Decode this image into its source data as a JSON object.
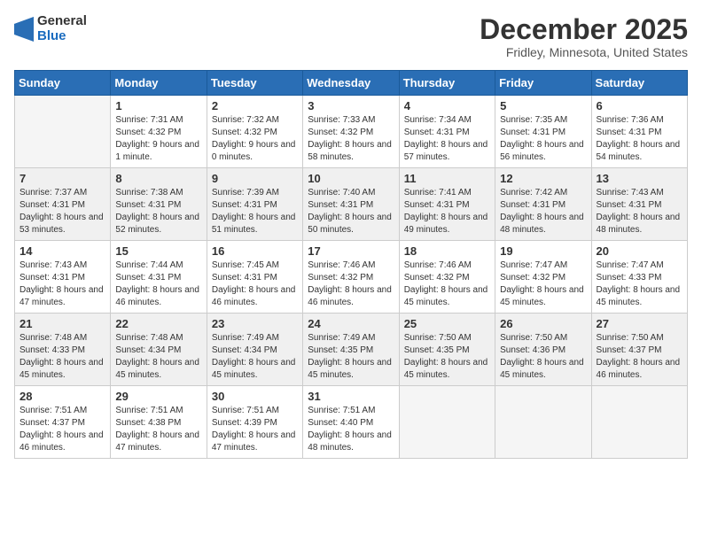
{
  "logo": {
    "general": "General",
    "blue": "Blue"
  },
  "title": "December 2025",
  "location": "Fridley, Minnesota, United States",
  "days_header": [
    "Sunday",
    "Monday",
    "Tuesday",
    "Wednesday",
    "Thursday",
    "Friday",
    "Saturday"
  ],
  "weeks": [
    [
      {
        "num": "",
        "empty": true
      },
      {
        "num": "1",
        "sunrise": "Sunrise: 7:31 AM",
        "sunset": "Sunset: 4:32 PM",
        "daylight": "Daylight: 9 hours and 1 minute."
      },
      {
        "num": "2",
        "sunrise": "Sunrise: 7:32 AM",
        "sunset": "Sunset: 4:32 PM",
        "daylight": "Daylight: 9 hours and 0 minutes."
      },
      {
        "num": "3",
        "sunrise": "Sunrise: 7:33 AM",
        "sunset": "Sunset: 4:32 PM",
        "daylight": "Daylight: 8 hours and 58 minutes."
      },
      {
        "num": "4",
        "sunrise": "Sunrise: 7:34 AM",
        "sunset": "Sunset: 4:31 PM",
        "daylight": "Daylight: 8 hours and 57 minutes."
      },
      {
        "num": "5",
        "sunrise": "Sunrise: 7:35 AM",
        "sunset": "Sunset: 4:31 PM",
        "daylight": "Daylight: 8 hours and 56 minutes."
      },
      {
        "num": "6",
        "sunrise": "Sunrise: 7:36 AM",
        "sunset": "Sunset: 4:31 PM",
        "daylight": "Daylight: 8 hours and 54 minutes."
      }
    ],
    [
      {
        "num": "7",
        "sunrise": "Sunrise: 7:37 AM",
        "sunset": "Sunset: 4:31 PM",
        "daylight": "Daylight: 8 hours and 53 minutes."
      },
      {
        "num": "8",
        "sunrise": "Sunrise: 7:38 AM",
        "sunset": "Sunset: 4:31 PM",
        "daylight": "Daylight: 8 hours and 52 minutes."
      },
      {
        "num": "9",
        "sunrise": "Sunrise: 7:39 AM",
        "sunset": "Sunset: 4:31 PM",
        "daylight": "Daylight: 8 hours and 51 minutes."
      },
      {
        "num": "10",
        "sunrise": "Sunrise: 7:40 AM",
        "sunset": "Sunset: 4:31 PM",
        "daylight": "Daylight: 8 hours and 50 minutes."
      },
      {
        "num": "11",
        "sunrise": "Sunrise: 7:41 AM",
        "sunset": "Sunset: 4:31 PM",
        "daylight": "Daylight: 8 hours and 49 minutes."
      },
      {
        "num": "12",
        "sunrise": "Sunrise: 7:42 AM",
        "sunset": "Sunset: 4:31 PM",
        "daylight": "Daylight: 8 hours and 48 minutes."
      },
      {
        "num": "13",
        "sunrise": "Sunrise: 7:43 AM",
        "sunset": "Sunset: 4:31 PM",
        "daylight": "Daylight: 8 hours and 48 minutes."
      }
    ],
    [
      {
        "num": "14",
        "sunrise": "Sunrise: 7:43 AM",
        "sunset": "Sunset: 4:31 PM",
        "daylight": "Daylight: 8 hours and 47 minutes."
      },
      {
        "num": "15",
        "sunrise": "Sunrise: 7:44 AM",
        "sunset": "Sunset: 4:31 PM",
        "daylight": "Daylight: 8 hours and 46 minutes."
      },
      {
        "num": "16",
        "sunrise": "Sunrise: 7:45 AM",
        "sunset": "Sunset: 4:31 PM",
        "daylight": "Daylight: 8 hours and 46 minutes."
      },
      {
        "num": "17",
        "sunrise": "Sunrise: 7:46 AM",
        "sunset": "Sunset: 4:32 PM",
        "daylight": "Daylight: 8 hours and 46 minutes."
      },
      {
        "num": "18",
        "sunrise": "Sunrise: 7:46 AM",
        "sunset": "Sunset: 4:32 PM",
        "daylight": "Daylight: 8 hours and 45 minutes."
      },
      {
        "num": "19",
        "sunrise": "Sunrise: 7:47 AM",
        "sunset": "Sunset: 4:32 PM",
        "daylight": "Daylight: 8 hours and 45 minutes."
      },
      {
        "num": "20",
        "sunrise": "Sunrise: 7:47 AM",
        "sunset": "Sunset: 4:33 PM",
        "daylight": "Daylight: 8 hours and 45 minutes."
      }
    ],
    [
      {
        "num": "21",
        "sunrise": "Sunrise: 7:48 AM",
        "sunset": "Sunset: 4:33 PM",
        "daylight": "Daylight: 8 hours and 45 minutes."
      },
      {
        "num": "22",
        "sunrise": "Sunrise: 7:48 AM",
        "sunset": "Sunset: 4:34 PM",
        "daylight": "Daylight: 8 hours and 45 minutes."
      },
      {
        "num": "23",
        "sunrise": "Sunrise: 7:49 AM",
        "sunset": "Sunset: 4:34 PM",
        "daylight": "Daylight: 8 hours and 45 minutes."
      },
      {
        "num": "24",
        "sunrise": "Sunrise: 7:49 AM",
        "sunset": "Sunset: 4:35 PM",
        "daylight": "Daylight: 8 hours and 45 minutes."
      },
      {
        "num": "25",
        "sunrise": "Sunrise: 7:50 AM",
        "sunset": "Sunset: 4:35 PM",
        "daylight": "Daylight: 8 hours and 45 minutes."
      },
      {
        "num": "26",
        "sunrise": "Sunrise: 7:50 AM",
        "sunset": "Sunset: 4:36 PM",
        "daylight": "Daylight: 8 hours and 45 minutes."
      },
      {
        "num": "27",
        "sunrise": "Sunrise: 7:50 AM",
        "sunset": "Sunset: 4:37 PM",
        "daylight": "Daylight: 8 hours and 46 minutes."
      }
    ],
    [
      {
        "num": "28",
        "sunrise": "Sunrise: 7:51 AM",
        "sunset": "Sunset: 4:37 PM",
        "daylight": "Daylight: 8 hours and 46 minutes."
      },
      {
        "num": "29",
        "sunrise": "Sunrise: 7:51 AM",
        "sunset": "Sunset: 4:38 PM",
        "daylight": "Daylight: 8 hours and 47 minutes."
      },
      {
        "num": "30",
        "sunrise": "Sunrise: 7:51 AM",
        "sunset": "Sunset: 4:39 PM",
        "daylight": "Daylight: 8 hours and 47 minutes."
      },
      {
        "num": "31",
        "sunrise": "Sunrise: 7:51 AM",
        "sunset": "Sunset: 4:40 PM",
        "daylight": "Daylight: 8 hours and 48 minutes."
      },
      {
        "num": "",
        "empty": true
      },
      {
        "num": "",
        "empty": true
      },
      {
        "num": "",
        "empty": true
      }
    ]
  ]
}
